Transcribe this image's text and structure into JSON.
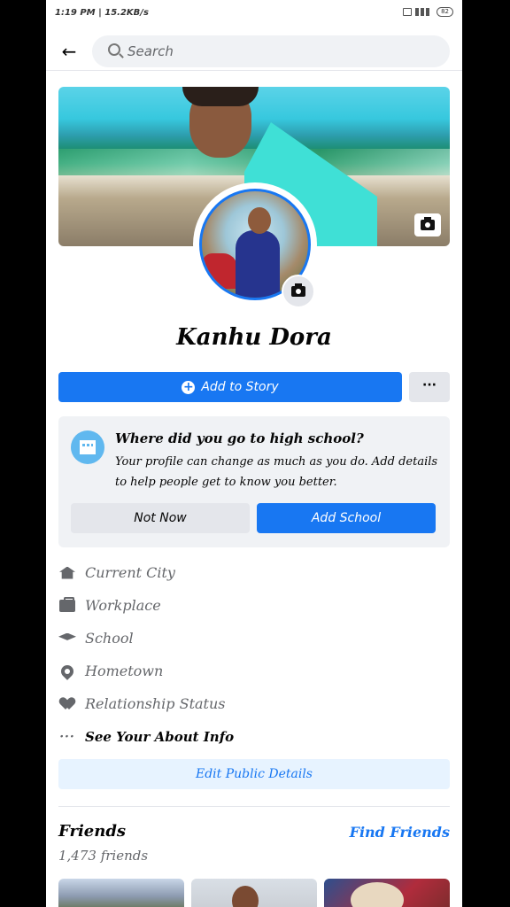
{
  "status_bar": {
    "time": "1:19 PM | 15.2KB/s",
    "battery": "82"
  },
  "header": {
    "search_placeholder": "Search"
  },
  "profile": {
    "name": "Kanhu Dora",
    "add_to_story_label": "Add to Story",
    "more_label": "···"
  },
  "school_prompt": {
    "title": "Where did you go to high school?",
    "description": "Your profile can change as much as you do. Add details to help people get to know you better.",
    "not_now_label": "Not Now",
    "add_school_label": "Add School"
  },
  "about": {
    "items": [
      {
        "icon": "home-icon",
        "label": "Current City"
      },
      {
        "icon": "briefcase-icon",
        "label": "Workplace"
      },
      {
        "icon": "graduation-cap-icon",
        "label": "School"
      },
      {
        "icon": "location-pin-icon",
        "label": "Hometown"
      },
      {
        "icon": "heart-icon",
        "label": "Relationship Status"
      }
    ],
    "see_about_label": "See Your About Info",
    "edit_details_label": "Edit Public Details"
  },
  "friends": {
    "title": "Friends",
    "count_label": "1,473 friends",
    "find_friends_label": "Find Friends"
  },
  "colors": {
    "accent": "#1877f2",
    "secondary_button": "#e4e6eb",
    "card_bg": "#f0f2f5"
  }
}
